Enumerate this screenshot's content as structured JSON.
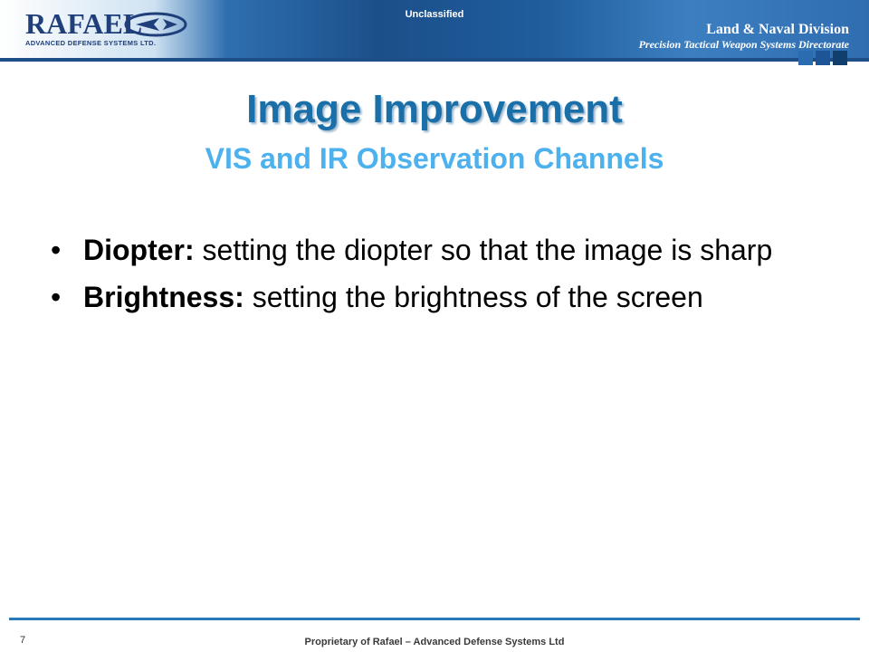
{
  "header": {
    "brand_name": "RAFAEL",
    "brand_subtitle": "ADVANCED DEFENSE SYSTEMS LTD.",
    "classification": "Unclassified",
    "division_title": "Land & Naval Division",
    "division_subtitle": "Precision Tactical Weapon Systems Directorate"
  },
  "slide": {
    "title": "Image Improvement",
    "subtitle": "VIS and IR Observation Channels",
    "bullets": [
      {
        "term": "Diopter:",
        "text": " setting the diopter so that the image is sharp"
      },
      {
        "term": "Brightness:",
        "text": " setting the brightness of the screen"
      }
    ]
  },
  "footer": {
    "page_number": "7",
    "text": "Proprietary of Rafael – Advanced Defense Systems Ltd"
  },
  "colors": {
    "title": "#1a6fa8",
    "subtitle": "#4db1ee",
    "banner_dark": "#1b4f8a",
    "footer_line": "#2a79b8"
  }
}
